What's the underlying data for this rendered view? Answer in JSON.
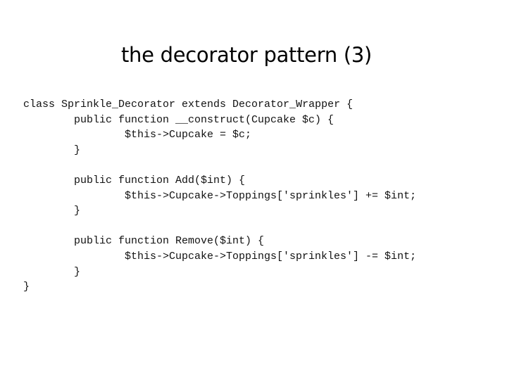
{
  "slide": {
    "title": "the decorator pattern (3)",
    "code_lines": [
      {
        "indent": 0,
        "text": "class Sprinkle_Decorator extends Decorator_Wrapper {"
      },
      {
        "indent": 1,
        "text": "public function __construct(Cupcake $c) {"
      },
      {
        "indent": 2,
        "text": "$this->Cupcake = $c;"
      },
      {
        "indent": 1,
        "text": "}"
      },
      {
        "indent": 0,
        "text": ""
      },
      {
        "indent": 1,
        "text": "public function Add($int) {"
      },
      {
        "indent": 2,
        "text": "$this->Cupcake->Toppings['sprinkles'] += $int;"
      },
      {
        "indent": 1,
        "text": "}"
      },
      {
        "indent": 0,
        "text": ""
      },
      {
        "indent": 1,
        "text": "public function Remove($int) {"
      },
      {
        "indent": 2,
        "text": "$this->Cupcake->Toppings['sprinkles'] -= $int;"
      },
      {
        "indent": 1,
        "text": "}"
      },
      {
        "indent": 0,
        "text": "}"
      }
    ]
  }
}
